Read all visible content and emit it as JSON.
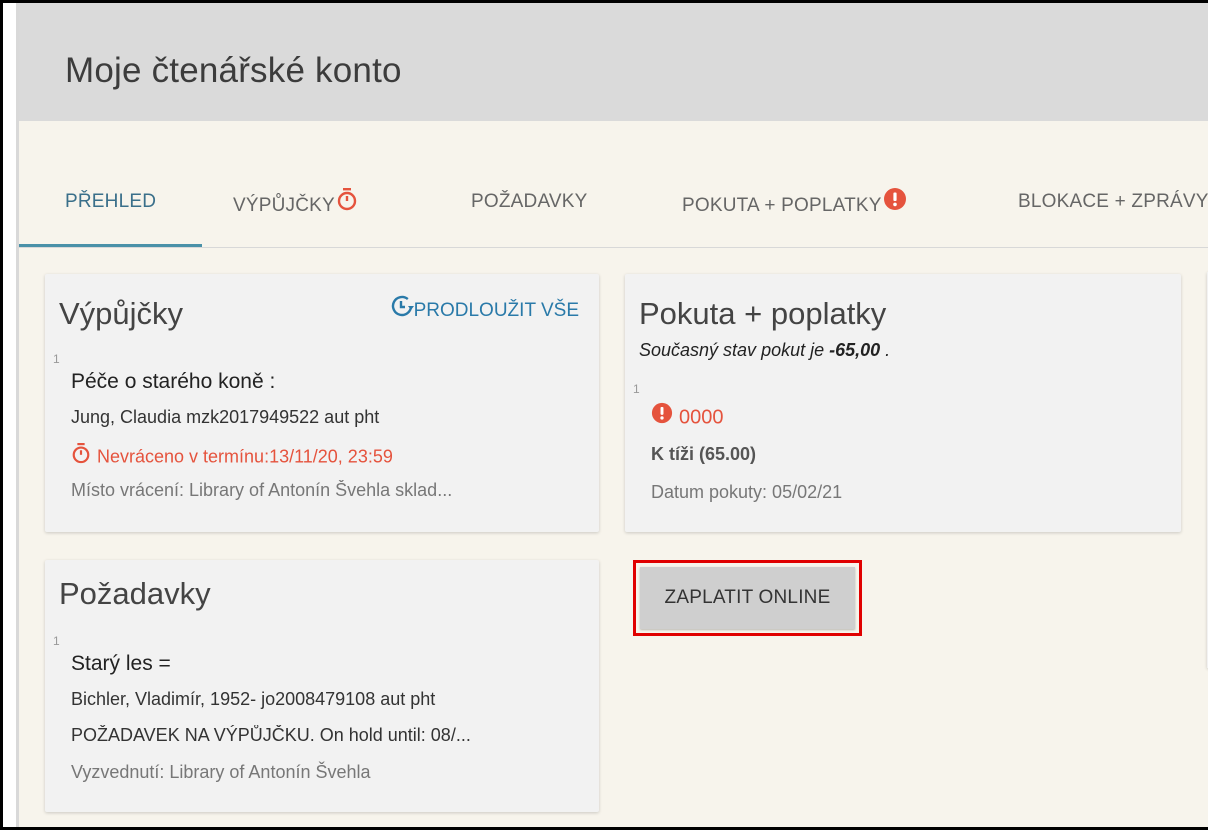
{
  "header": {
    "title": "Moje čtenářské konto"
  },
  "tabs": [
    {
      "label": "PŘEHLED",
      "active": true
    },
    {
      "label": "VÝPŮJČKY",
      "icon": "timer-icon",
      "icon_color": "#e5533d"
    },
    {
      "label": "POŽADAVKY"
    },
    {
      "label": "POKUTA + POPLATKY",
      "icon": "alert-icon",
      "icon_color": "#e5533d"
    },
    {
      "label": "BLOKACE + ZPRÁVY"
    }
  ],
  "loans": {
    "title": "Výpůjčky",
    "renew_all": "PRODLOUŽIT VŠE",
    "item": {
      "index": "1",
      "title": "Péče o starého koně :",
      "author": "Jung, Claudia mzk2017949522 aut pht",
      "overdue": "Nevráceno v termínu:13/11/20, 23:59",
      "return_place": "Místo vrácení: Library of Antonín Švehla sklad..."
    }
  },
  "requests": {
    "title": "Požadavky",
    "item": {
      "index": "1",
      "title": "Starý les =",
      "author": "Bichler, Vladimír, 1952- jo2008479108 aut pht",
      "status": "POŽADAVEK NA VÝPŮJČKU. On hold until: 08/...",
      "pickup": "Vyzvednutí: Library of Antonín Švehla"
    }
  },
  "fines": {
    "title": "Pokuta + poplatky",
    "summary_prefix": "Současný stav pokut je ",
    "summary_amount": "-65,00",
    "summary_suffix": " .",
    "item": {
      "index": "1",
      "code": "0000",
      "balance": "K tíži (65.00)",
      "date": "Datum pokuty: 05/02/21"
    },
    "pay_button": "ZAPLATIT ONLINE"
  },
  "colors": {
    "accent": "#4a91a8",
    "alert": "#e5533d",
    "link": "#2a7aa9"
  }
}
